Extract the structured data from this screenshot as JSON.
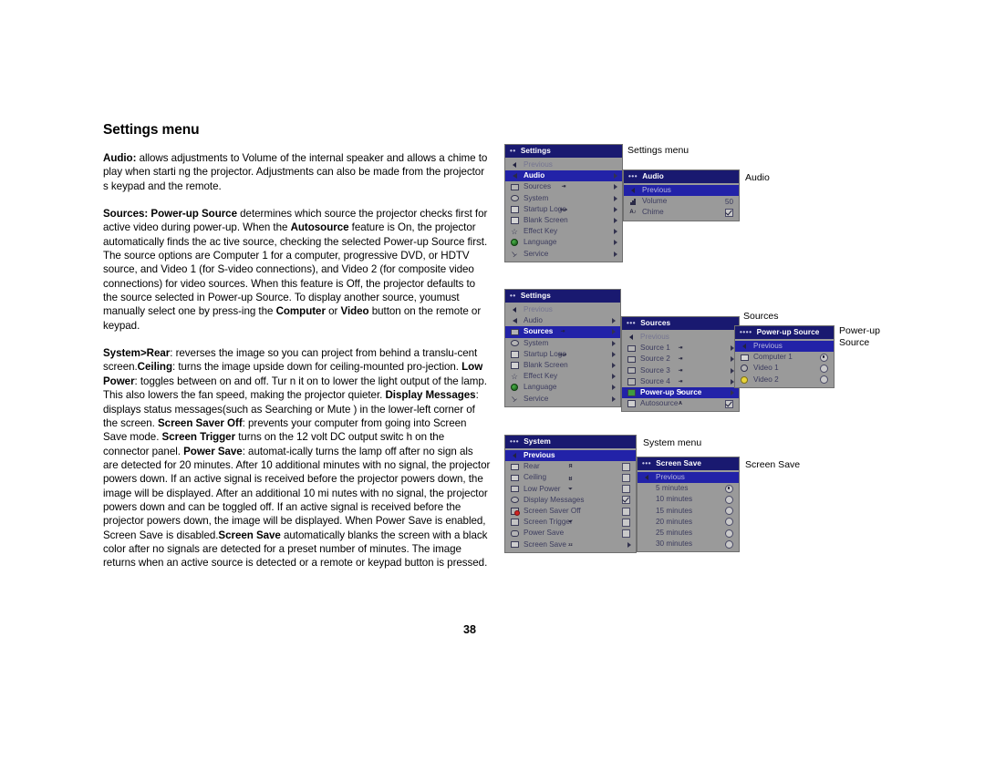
{
  "document": {
    "page_title": "Settings menu",
    "page_number": "38",
    "paragraphs": [
      {
        "id": "audio-para",
        "runs": [
          {
            "text": "Audio:",
            "bold": true
          },
          {
            "text": " allows adjustments to Volume of the internal speaker and allows a chime to play when starti ng the projector. Adjustments can also be made from the projector s keypad and the remote.",
            "bold": false
          }
        ]
      },
      {
        "id": "sources-para",
        "runs": [
          {
            "text": "Sources: Power-up Source",
            "bold": true
          },
          {
            "text": " determines which source the projector checks first for active video during power-up. When the  ",
            "bold": false
          },
          {
            "text": "Autosource",
            "bold": true
          },
          {
            "text": " feature is On, the projector automatically finds the ac tive source, checking the selected Power-up Source first. The source options are Computer 1 for a computer, progressive DVD, or HDTV source, and Video 1 (for S-video connections), and Video 2 (for composite video connections) for video sources. When this feature is Off, the projector defaults to the source selected in Power-up Source. To display another source, youmust manually select one by press-ing the ",
            "bold": false
          },
          {
            "text": "Computer",
            "bold": true
          },
          {
            "text": " or ",
            "bold": false
          },
          {
            "text": "Video",
            "bold": true
          },
          {
            "text": " button on the remote or keypad.",
            "bold": false
          }
        ]
      },
      {
        "id": "system-para",
        "runs": [
          {
            "text": "System>Rear",
            "bold": true
          },
          {
            "text": ": reverses the image so you can project from behind a translu-cent screen.",
            "bold": false
          },
          {
            "text": "Ceiling",
            "bold": true
          },
          {
            "text": ": turns the image upside down for ceiling-mounted pro-jection. ",
            "bold": false
          },
          {
            "text": "Low Power",
            "bold": true
          },
          {
            "text": ": toggles between on and off. Tur n it on to lower the light output of the lamp. This also lowers  the fan speed, making the projector quieter. ",
            "bold": false
          },
          {
            "text": "Display Messages",
            "bold": true
          },
          {
            "text": ": displays status messages(such as  Searching  or  Mute ) in the lower-left corner of the screen.   ",
            "bold": false
          },
          {
            "text": "Screen Saver Off",
            "bold": true
          },
          {
            "text": ": prevents your computer from going into Screen Save mode. ",
            "bold": false
          },
          {
            "text": "Screen Trigger",
            "bold": true
          },
          {
            "text": " turns on the 12 volt DC output switc h on the connector panel. ",
            "bold": false
          },
          {
            "text": "Power Save",
            "bold": true
          },
          {
            "text": ": automat-ically turns the lamp off after no sign als are detected for 20 minutes. After 10 additional minutes with no signal, the projector powers down. If an active signal is received before the projector powers down, the image will be displayed. After an additional 10 mi nutes with no signal, the projector powers down and can be toggled off. If  an active signal is received before the projector powers down, the image will be displayed. When Power Save is enabled, Screen Save is disabled.",
            "bold": false
          },
          {
            "text": "Screen Save",
            "bold": true
          },
          {
            "text": " automatically blanks the screen with a black color after no signals are detected for a preset number of minutes. The image returns when an active source is detected or a remote or keypad button is pressed.",
            "bold": false
          }
        ]
      }
    ]
  },
  "captions": {
    "settings_menu": "Settings menu",
    "audio": "Audio",
    "sources": "Sources",
    "power_up_source": "Power-up\nSource",
    "system_menu": "System menu",
    "screen_save": "Screen Save"
  },
  "colors": {
    "title_bar": "#191970",
    "menu_body": "#9a9a9a",
    "highlight": "#2222a8",
    "menu_border": "#6f6f6f",
    "label_text": "#3c3c5e"
  },
  "menus": {
    "settings_1": {
      "dots": "••",
      "title": "Settings",
      "rows": [
        {
          "icon": "back-arrow-icon",
          "label": "Previous",
          "state": "previous"
        },
        {
          "icon": "speaker-icon",
          "label": "Audio",
          "state": "selected",
          "arrow": "▶"
        },
        {
          "icon": "source-input-icon",
          "label": "Sources",
          "arrow": "▶"
        },
        {
          "icon": "system-icon",
          "label": "System",
          "arrow": "▶"
        },
        {
          "icon": "logo-icon",
          "label": "Startup Logo",
          "arrow": "▶"
        },
        {
          "icon": "blank-screen-icon",
          "label": "Blank Screen",
          "arrow": "▶"
        },
        {
          "icon": "star-icon",
          "label": "Effect Key",
          "arrow": "▶"
        },
        {
          "icon": "globe-icon",
          "label": "Language",
          "arrow": "▶"
        },
        {
          "icon": "wrench-icon",
          "label": "Service",
          "arrow": "▶"
        }
      ]
    },
    "audio": {
      "dots": "•••",
      "title": "Audio",
      "rows": [
        {
          "icon": "back-arrow-icon",
          "label": "Previous",
          "state": "selected-previous"
        },
        {
          "icon": "volume-icon",
          "label": "Volume",
          "value": "50"
        },
        {
          "icon": "chime-icon",
          "label": "Chime",
          "control": "checkbox",
          "checked": true
        }
      ]
    },
    "settings_2": {
      "dots": "••",
      "title": "Settings",
      "rows": [
        {
          "icon": "back-arrow-icon",
          "label": "Previous",
          "state": "previous"
        },
        {
          "icon": "speaker-icon",
          "label": "Audio",
          "arrow": "▶"
        },
        {
          "icon": "source-input-icon",
          "label": "Sources",
          "state": "selected",
          "arrow": "▶"
        },
        {
          "icon": "system-icon",
          "label": "System",
          "arrow": "▶"
        },
        {
          "icon": "logo-icon",
          "label": "Startup Logo",
          "arrow": "▶"
        },
        {
          "icon": "blank-screen-icon",
          "label": "Blank Screen",
          "arrow": "▶"
        },
        {
          "icon": "star-icon",
          "label": "Effect Key",
          "arrow": "▶"
        },
        {
          "icon": "globe-icon",
          "label": "Language",
          "arrow": "▶"
        },
        {
          "icon": "wrench-icon",
          "label": "Service",
          "arrow": "▶"
        }
      ]
    },
    "sources": {
      "dots": "•••",
      "title": "Sources",
      "rows": [
        {
          "icon": "back-arrow-icon",
          "label": "Previous",
          "state": "previous"
        },
        {
          "icon": "source-input-icon",
          "label": "Source 1",
          "arrow": "▶"
        },
        {
          "icon": "source-input-icon",
          "label": "Source 2",
          "arrow": "▶"
        },
        {
          "icon": "source-input-icon",
          "label": "Source 3",
          "arrow": "▶"
        },
        {
          "icon": "source-input-icon",
          "label": "Source 4",
          "arrow": "▶"
        },
        {
          "icon": "power-up-source-icon",
          "label": "Power-up Source",
          "state": "selected",
          "arrow": "▶"
        },
        {
          "icon": "autosource-icon",
          "label": "Autosource",
          "control": "checkbox",
          "checked": true
        }
      ]
    },
    "power_up_source": {
      "dots": "••••",
      "title": "Power-up Source",
      "rows": [
        {
          "icon": "back-arrow-icon",
          "label": "Previous",
          "state": "selected-previous"
        },
        {
          "icon": "computer-icon",
          "label": "Computer 1",
          "control": "radio",
          "checked": true
        },
        {
          "icon": "video1-icon",
          "label": "Video 1",
          "control": "radio",
          "checked": false
        },
        {
          "icon": "video2-icon",
          "label": "Video 2",
          "control": "radio",
          "checked": false
        }
      ]
    },
    "system": {
      "dots": "•••",
      "title": "System",
      "rows": [
        {
          "icon": "back-arrow-icon",
          "label": "Previous",
          "state": "selected-previous-bold"
        },
        {
          "icon": "rear-icon",
          "label": "Rear",
          "control": "checkbox",
          "checked": false
        },
        {
          "icon": "ceiling-icon",
          "label": "Ceiling",
          "control": "checkbox",
          "checked": false
        },
        {
          "icon": "low-power-icon",
          "label": "Low Power",
          "control": "checkbox",
          "checked": false
        },
        {
          "icon": "display-messages-icon",
          "label": "Display Messages",
          "control": "checkbox",
          "checked": true
        },
        {
          "icon": "screen-saver-off-icon",
          "label": "Screen Saver Off",
          "control": "checkbox",
          "checked": false
        },
        {
          "icon": "screen-trigger-icon",
          "label": "Screen Trigger",
          "control": "checkbox",
          "checked": false
        },
        {
          "icon": "power-save-icon",
          "label": "Power Save",
          "control": "checkbox",
          "checked": false
        },
        {
          "icon": "screen-save-icon",
          "label": "Screen Save",
          "arrow": "▶"
        }
      ]
    },
    "screen_save": {
      "dots": "•••",
      "title": "Screen Save",
      "rows": [
        {
          "icon": "back-arrow-icon",
          "label": "Previous",
          "state": "selected-previous"
        },
        {
          "label": "5 minutes",
          "control": "radio",
          "checked": true
        },
        {
          "label": "10 minutes",
          "control": "radio",
          "checked": false
        },
        {
          "label": "15 minutes",
          "control": "radio",
          "checked": false
        },
        {
          "label": "20 minutes",
          "control": "radio",
          "checked": false
        },
        {
          "label": "25 minutes",
          "control": "radio",
          "checked": false
        },
        {
          "label": "30 minutes",
          "control": "radio",
          "checked": false
        }
      ]
    }
  }
}
